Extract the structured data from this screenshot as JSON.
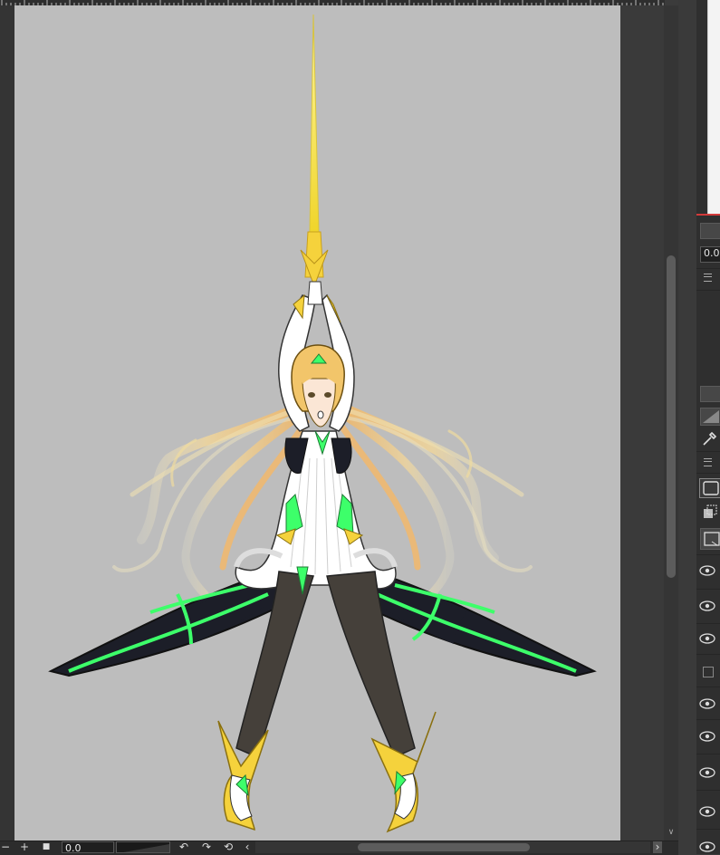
{
  "canvas": {
    "background": "#bdbdbd",
    "artwork": "illustration-in-progress"
  },
  "bottom_bar": {
    "zoom_out": "−",
    "zoom_in": "+",
    "stop": "■",
    "zoom_value": "0.0",
    "rotate_left": "↶",
    "rotate_right": "↷",
    "reset_rotation": "⟲",
    "scroll_left": "‹",
    "scroll_right": "›"
  },
  "right_panel": {
    "opacity_value": "0.0",
    "accent": "#d23a3a"
  },
  "colors": {
    "hair": "#f2c56a",
    "armor_green": "#3dff6a",
    "armor_gold": "#f5d23c",
    "dark_panel": "#1c1e28"
  }
}
